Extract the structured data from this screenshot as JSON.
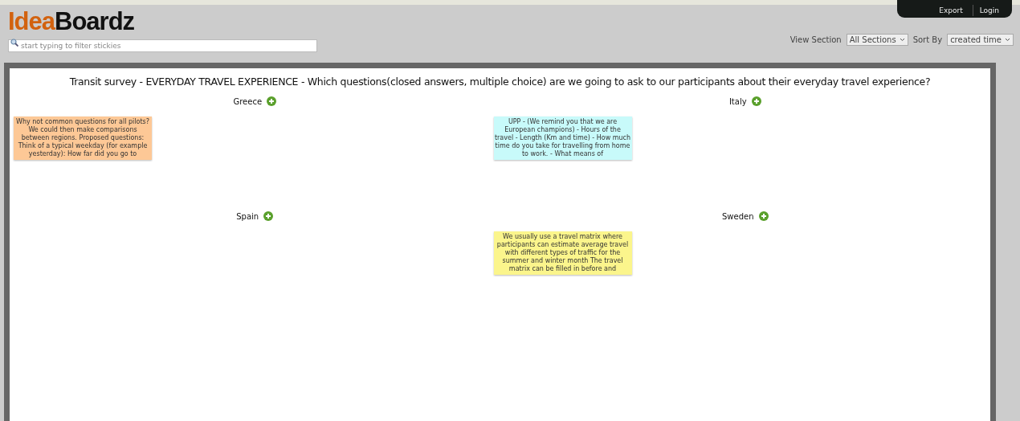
{
  "logo": {
    "part_1": "Idea",
    "part_2": "Boardz"
  },
  "search": {
    "placeholder": "start typing to filter stickies"
  },
  "menu": [
    "Export",
    "Login"
  ],
  "view_section": {
    "label": "View Section",
    "value": "All Sections"
  },
  "sort_by": {
    "label": "Sort By",
    "value": "created time"
  },
  "board": {
    "title": "Transit survey - EVERYDAY TRAVEL EXPERIENCE - Which questions(closed answers, multiple choice) are we going to ask to our participants about their everyday travel experience?",
    "sections": [
      {
        "name": "Greece",
        "stickies": [
          {
            "text": "Why not common questions for all pilots? We could then make comparisons between regions. Proposed questions: Think of a typical weekday (for example yesterday): How far did you go to",
            "color": "#fdc896"
          }
        ]
      },
      {
        "name": "Italy",
        "stickies": [
          {
            "text": "UPP - (We remind you that we are European champions) - Hours of the travel - Length (Km and time) - How much time do you take for travelling from home to work. - What means of",
            "color": "#c8fafa"
          }
        ]
      },
      {
        "name": "Spain"
      },
      {
        "name": "Sweden",
        "stickies": [
          {
            "text": "We usually use a travel matrix where participants can estimate average travel with different types of traffic for the summer and winter month The travel matrix can be filled in before and",
            "color": "#fbf58c"
          }
        ]
      }
    ]
  }
}
